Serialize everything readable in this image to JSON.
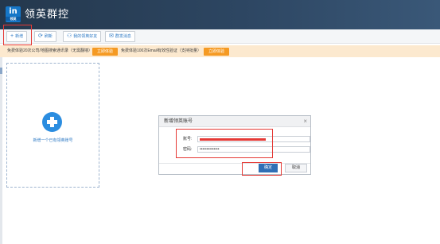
{
  "app": {
    "logo_text": "in",
    "logo_subtext": "领英",
    "title": "领英群控"
  },
  "toolbar": {
    "add_icon": "+",
    "add_label": "新增",
    "refresh_icon": "⟳",
    "refresh_label": "刷新",
    "friends_icon": "⚇",
    "friends_label": "我的领英好友",
    "message_icon": "✉",
    "message_label": "群发消息"
  },
  "banner": {
    "text_1": "免费体验20次公司/地图搜索通讯录（无需翻墙）",
    "button_1": "立即体验",
    "text_2": "免费体验100次Email有效性验证（支持批量）",
    "button_2": "立即体验"
  },
  "card": {
    "label": "新增一个已有领英账号"
  },
  "dialog": {
    "title": "新增领英账号",
    "close_icon": "×",
    "account_label": "账号:",
    "account_value": "",
    "password_label": "密码:",
    "password_value": "••••••••••••••",
    "confirm_label": "确定",
    "cancel_label": "取消"
  },
  "colors": {
    "titlebar": "#2d4662",
    "accent_blue": "#2b78c4",
    "banner_bg": "#fce9cf",
    "banner_button": "#f59a23",
    "highlight_red": "#e53935",
    "confirm_button": "#2f6fb5"
  }
}
